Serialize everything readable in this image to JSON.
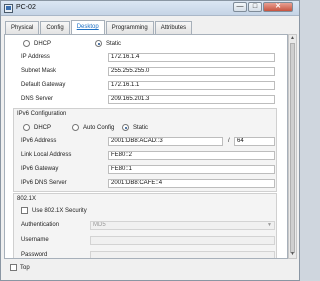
{
  "window": {
    "title": "PC-02",
    "minimize": "—",
    "maximize": "□",
    "close": "✕"
  },
  "tabs": [
    "Physical",
    "Config",
    "Desktop",
    "Programming",
    "Attributes"
  ],
  "ipv4": {
    "dhcp_label": "DHCP",
    "static_label": "Static",
    "ip_label": "IP Address",
    "ip_value": "172.16.1.4",
    "mask_label": "Subnet Mask",
    "mask_value": "255.255.255.0",
    "gateway_label": "Default Gateway",
    "gateway_value": "172.16.1.1",
    "dns_label": "DNS Server",
    "dns_value": "209.165.201.3"
  },
  "ipv6": {
    "header": "IPv6 Configuration",
    "dhcp_label": "DHCP",
    "auto_label": "Auto Config",
    "static_label": "Static",
    "addr_label": "IPv6 Address",
    "addr_value": "2001:DB8:ACAD::3",
    "slash": "/",
    "prefix": "64",
    "link_label": "Link Local Address",
    "link_value": "FE80::2",
    "gateway_label": "IPv6 Gateway",
    "gateway_value": "FE80::1",
    "dns_label": "IPv6 DNS Server",
    "dns_value": "2001:DB8:CAFE::4"
  },
  "dot1x": {
    "header": "802.1X",
    "use_label": "Use 802.1X Security",
    "auth_label": "Authentication",
    "auth_value": "MD5",
    "user_label": "Username",
    "pass_label": "Password"
  },
  "footer": {
    "top_label": "Top"
  }
}
